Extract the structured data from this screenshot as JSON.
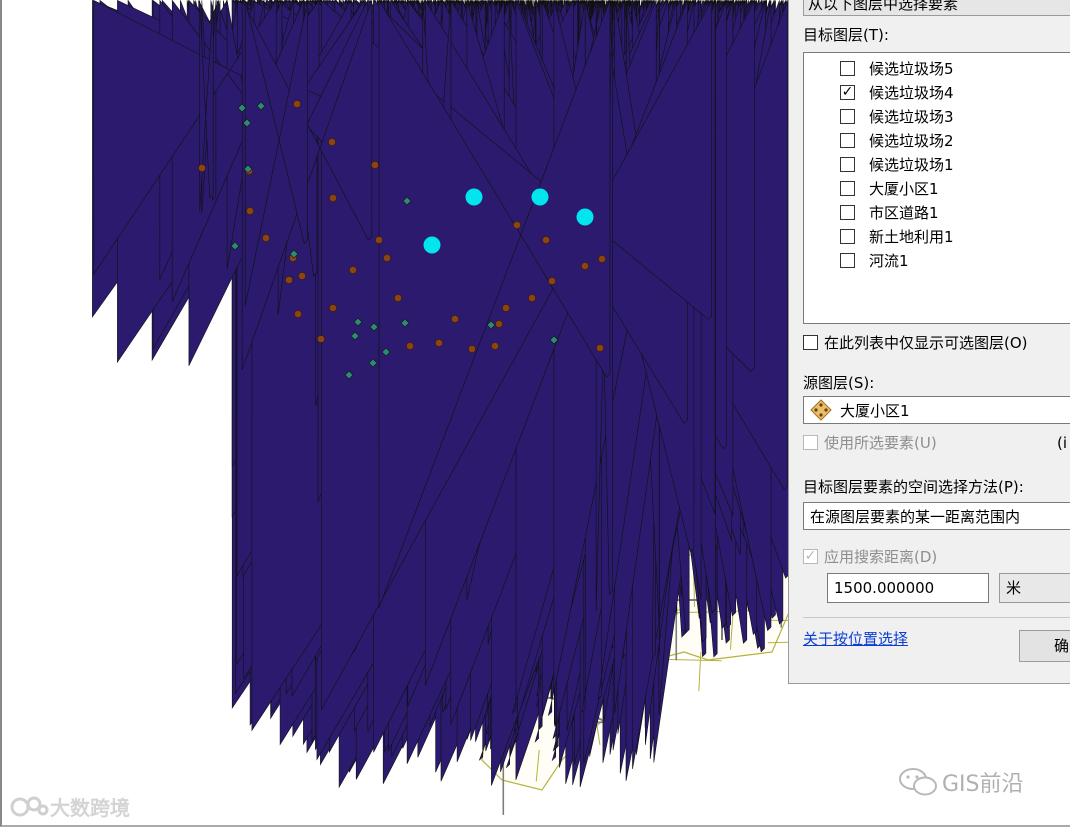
{
  "dialog": {
    "top_text": "从以下图层中选择要素",
    "target_layers_label": "目标图层(T):",
    "layers": [
      {
        "name": "候选垃圾场5",
        "checked": false
      },
      {
        "name": "候选垃圾场4",
        "checked": true
      },
      {
        "name": "候选垃圾场3",
        "checked": false
      },
      {
        "name": "候选垃圾场2",
        "checked": false
      },
      {
        "name": "候选垃圾场1",
        "checked": false
      },
      {
        "name": "大厦小区1",
        "checked": false
      },
      {
        "name": "市区道路1",
        "checked": false
      },
      {
        "name": "新土地利用1",
        "checked": false
      },
      {
        "name": "河流1",
        "checked": false
      }
    ],
    "only_selectable_label": "在此列表中仅显示可选图层(O)",
    "source_layer_label": "源图层(S):",
    "source_layer_value": "大厦小区1",
    "use_selected_label": "使用所选要素(U)",
    "use_selected_count": "(i",
    "method_label": "目标图层要素的空间选择方法(P):",
    "method_value": "在源图层要素的某一距离范围内",
    "apply_distance_label": "应用搜索距离(D)",
    "distance_value": "1500.000000",
    "distance_unit": "米",
    "help_link": "关于按位置选择",
    "ok_button": "确"
  },
  "map": {
    "colors": {
      "building_point": "#2b1a6e",
      "candidate_brown": "#8b4513",
      "candidate_teal": "#2e8b73",
      "selected_cyan": "#00e5ee",
      "road_yellow": "#b5b23c",
      "road_gray": "#7d7d7d",
      "land_fill": "#fffdf6",
      "boundary_accent": "#f0c9a0"
    }
  },
  "watermarks": {
    "left": "大数跨境",
    "right": "GIS前沿"
  }
}
